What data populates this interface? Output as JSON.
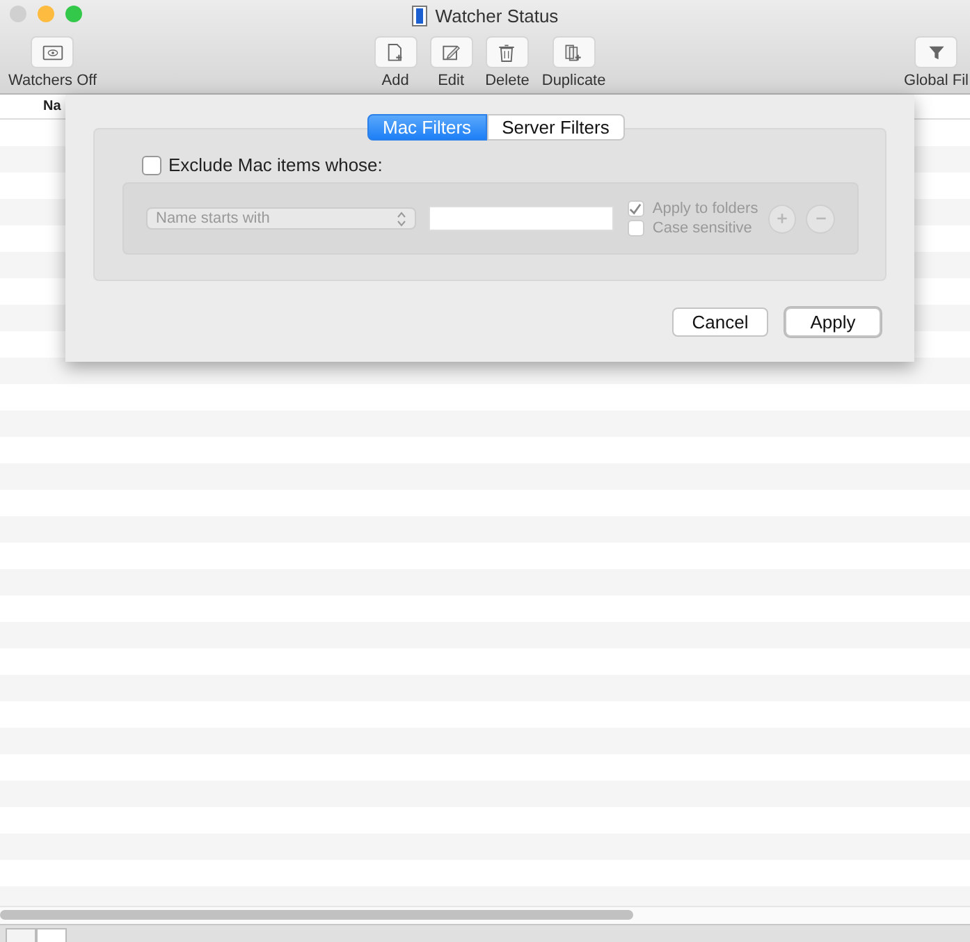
{
  "window": {
    "title": "Watcher Status"
  },
  "toolbar": {
    "left": [
      {
        "label": "Watchers Off",
        "kind": "eye"
      }
    ],
    "center": [
      {
        "label": "Add",
        "kind": "add"
      },
      {
        "label": "Edit",
        "kind": "edit"
      },
      {
        "label": "Delete",
        "kind": "delete"
      },
      {
        "label": "Duplicate",
        "kind": "duplicate"
      }
    ],
    "right": [
      {
        "label": "Global Fil",
        "kind": "filter"
      }
    ]
  },
  "table": {
    "columns": [
      "Na"
    ]
  },
  "sheet": {
    "tabs": [
      {
        "label": "Mac Filters",
        "selected": true
      },
      {
        "label": "Server Filters",
        "selected": false
      }
    ],
    "exclude": {
      "label": "Exclude Mac items whose:",
      "checked": false
    },
    "rule": {
      "condition": "Name starts with",
      "disabled": true,
      "options": [
        {
          "label": "Apply to folders",
          "checked": true
        },
        {
          "label": "Case sensitive",
          "checked": false
        }
      ]
    },
    "buttons": [
      {
        "label": "Cancel",
        "kind": "cancel"
      },
      {
        "label": "Apply",
        "kind": "default"
      }
    ]
  }
}
